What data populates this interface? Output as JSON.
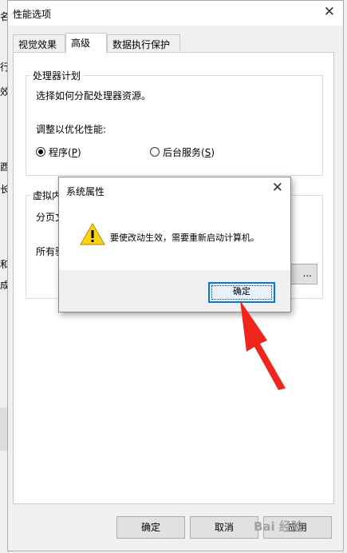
{
  "background": {
    "fragments": [
      "名",
      "行",
      "效",
      "酉",
      "长",
      "和",
      "成",
      "E"
    ]
  },
  "window": {
    "title": "性能选项",
    "close_glyph": "✕",
    "tabs": [
      "视觉效果",
      "高级",
      "数据执行保护"
    ],
    "processor": {
      "legend": "处理器计划",
      "description": "选择如何分配处理器资源。",
      "adjust_label": "调整以优化性能:",
      "option_programs": {
        "text": "程序(",
        "key": "P",
        "tail": ")"
      },
      "option_services": {
        "text": "后台服务(",
        "key": "S",
        "tail": ")"
      },
      "selected": "programs"
    },
    "virtual_memory": {
      "legend": "虚拟内",
      "line1": "分页文",
      "line2": "所有驱",
      "change_button": "..."
    },
    "buttons": {
      "ok": "确定",
      "cancel": "取消",
      "apply": "应用"
    }
  },
  "dialog": {
    "title": "系统属性",
    "close_glyph": "✕",
    "message": "要使改动生效，需要重新启动计算机。",
    "ok": "确定",
    "warning_color": "#fcd116"
  },
  "annotation": {
    "arrow_color": "#f0261c"
  },
  "watermark": "Bai 经验"
}
